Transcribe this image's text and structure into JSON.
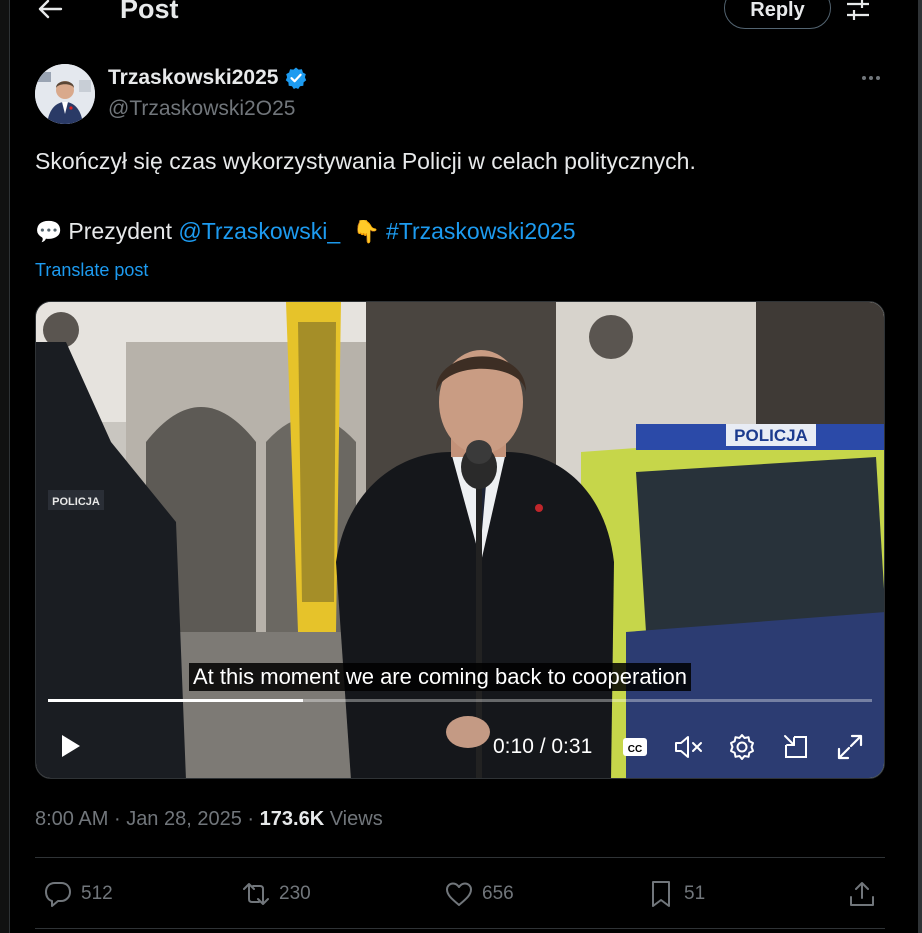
{
  "header": {
    "title": "Post",
    "reply_label": "Reply"
  },
  "author": {
    "display_name": "Trzaskowski2025",
    "handle": "@Trzaskowski2O25"
  },
  "tweet": {
    "line1": "Skończył się czas wykorzystywania Policji w celach politycznych.",
    "speech_emoji": "💬",
    "line2_text": "Prezydent",
    "mention": "@Trzaskowski_",
    "pointing_emoji": "👇",
    "hashtag": "#Trzaskowski2025",
    "translate_label": "Translate post"
  },
  "video": {
    "caption": "At this moment we are coming back to cooperation",
    "time": "0:10 / 0:31",
    "progress": 0.31,
    "police_sign": "POLICJA",
    "officer_patch": "POLICJA"
  },
  "meta": {
    "time": "8:00 AM",
    "date": "Jan 28, 2025",
    "views_count": "173.6K",
    "views_label": "Views",
    "separator": "·"
  },
  "actions": {
    "replies": "512",
    "reposts": "230",
    "likes": "656",
    "bookmarks": "51"
  },
  "colors": {
    "accent": "#1d9bf0",
    "muted": "#71767b",
    "text": "#e7e9ea",
    "border": "#2f3336"
  }
}
